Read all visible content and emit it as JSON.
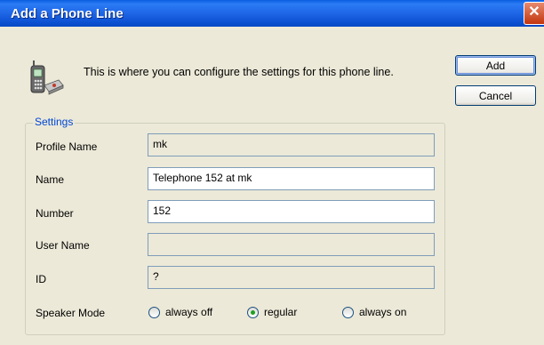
{
  "window": {
    "title": "Add a Phone Line",
    "close_glyph": "✕"
  },
  "intro_text": "This is where you can configure the settings for this phone line.",
  "buttons": {
    "add": "Add",
    "cancel": "Cancel"
  },
  "settings": {
    "legend": "Settings",
    "profile_name": {
      "label": "Profile Name",
      "value": "mk"
    },
    "name": {
      "label": "Name",
      "value": "Telephone 152 at mk"
    },
    "number": {
      "label": "Number",
      "value": "152"
    },
    "user_name": {
      "label": "User Name",
      "value": ""
    },
    "id": {
      "label": "ID",
      "value": "?"
    },
    "speaker_mode": {
      "label": "Speaker Mode",
      "options": [
        "always off",
        "regular",
        "always on"
      ],
      "selected": "regular"
    }
  },
  "icons": {
    "phone": "phone-icon",
    "close": "close-icon"
  },
  "colors": {
    "title_bar": "#0A5FE0",
    "dialog_bg": "#ECE9D8",
    "legend": "#0046D5",
    "close": "#C2350E"
  }
}
